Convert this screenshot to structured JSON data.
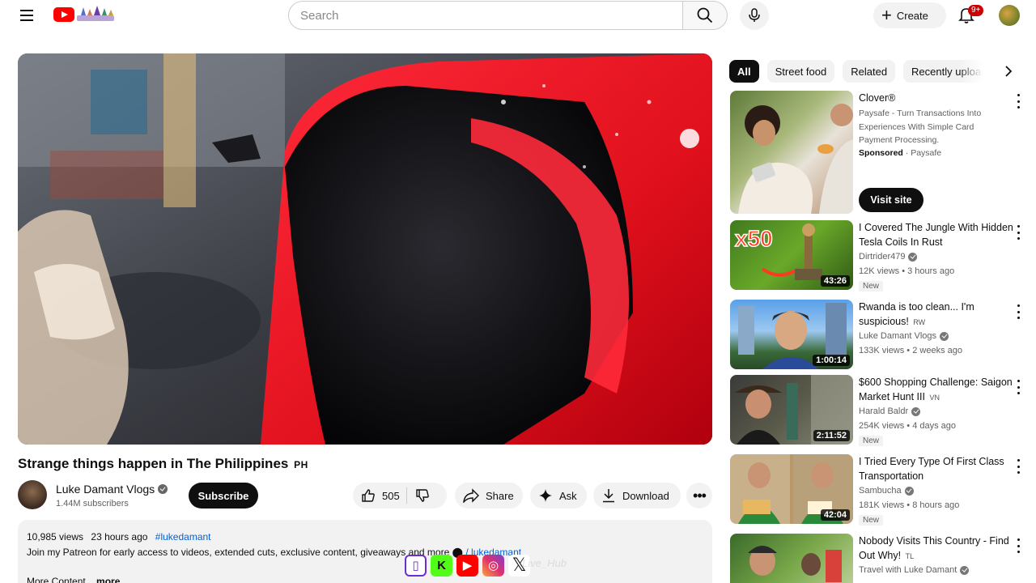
{
  "header": {
    "search_placeholder": "Search",
    "create_label": "Create",
    "notification_badge": "9+"
  },
  "video": {
    "title": "Strange things happen in The Philippines",
    "title_flag": "PH",
    "channel_name": "Luke Damant Vlogs",
    "subscribers": "1.44M subscribers",
    "subscribe_label": "Subscribe",
    "likes": "505",
    "share_label": "Share",
    "ask_label": "Ask",
    "download_label": "Download"
  },
  "description": {
    "views": "10,985 views",
    "age": "23 hours ago",
    "hashtag": "#lukedamant",
    "line": "Join my Patreon for early access to videos, extended cuts, exclusive content, giveaways and more",
    "patreon_link": "/ lukedamant",
    "more_content": "More Content",
    "more": "...more"
  },
  "overlay": {
    "watermark": "Live_Hub"
  },
  "chips": [
    "All",
    "Street food",
    "Related",
    "Recently uploaded"
  ],
  "ad": {
    "title": "Clover®",
    "description": "Paysafe - Turn Transactions Into Experiences With Simple Card Payment Processing.",
    "sponsored": "Sponsored",
    "advertiser": "Paysafe",
    "cta": "Visit site"
  },
  "recommendations": [
    {
      "title": "I Covered The Jungle With Hidden Tesla Coils In Rust",
      "channel": "Dirtrider479",
      "stats": "12K views • 3 hours ago",
      "duration": "43:26",
      "new_badge": "New",
      "lang": ""
    },
    {
      "title": "Rwanda is too clean... I'm suspicious!",
      "channel": "Luke Damant Vlogs",
      "stats": "133K views • 2 weeks ago",
      "duration": "1:00:14",
      "new_badge": "",
      "lang": "RW"
    },
    {
      "title": "$600 Shopping Challenge: Saigon Market Hunt III",
      "channel": "Harald Baldr",
      "stats": "254K views • 4 days ago",
      "duration": "2:11:52",
      "new_badge": "New",
      "lang": "VN"
    },
    {
      "title": "I Tried Every Type Of First Class Transportation",
      "channel": "Sambucha",
      "stats": "181K views • 8 hours ago",
      "duration": "42:04",
      "new_badge": "New",
      "lang": ""
    },
    {
      "title": "Nobody Visits This Country - Find Out Why!",
      "channel": "Travel with Luke Damant",
      "stats": "",
      "duration": "",
      "new_badge": "",
      "lang": "TL"
    }
  ]
}
